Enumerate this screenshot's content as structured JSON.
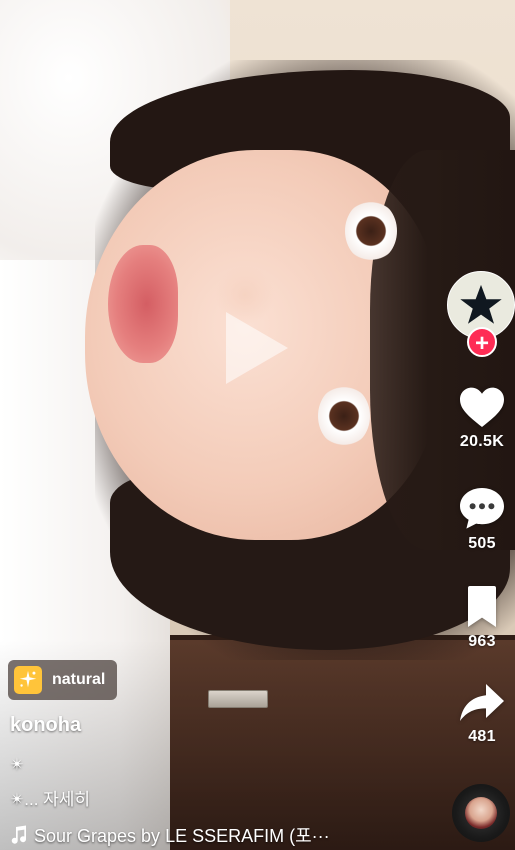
{
  "video": {
    "play_icon": "play-triangle"
  },
  "creator": {
    "avatar_icon": "star-icon",
    "follow_icon": "plus-icon",
    "accent_color": "#fe2c55"
  },
  "actions": {
    "like": {
      "icon": "heart-icon",
      "count": "20.5K"
    },
    "comment": {
      "icon": "comment-bubble-icon",
      "count": "505"
    },
    "bookmark": {
      "icon": "bookmark-icon",
      "count": "963"
    },
    "share": {
      "icon": "share-arrow-icon",
      "count": "481"
    }
  },
  "effect": {
    "icon": "sparkle-icon",
    "label": "natural"
  },
  "post": {
    "username": "konoha",
    "caption_lines": [
      "✴︎",
      "✴︎... 자세히"
    ]
  },
  "music": {
    "icon": "music-note-icon",
    "title": "Sour Grapes by LE SSERAFIM (포···",
    "disc_icon": "music-disc-icon"
  }
}
